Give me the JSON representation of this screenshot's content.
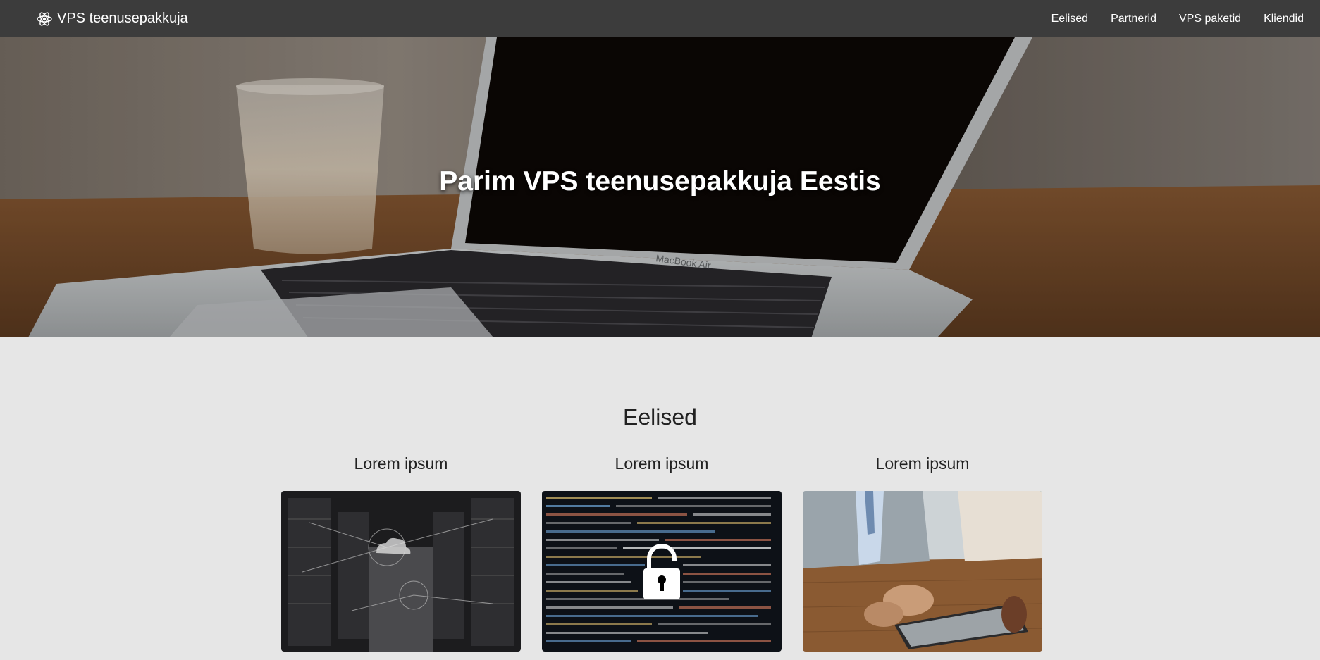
{
  "navbar": {
    "brand": "VPS teenusepakkuja",
    "links": [
      "Eelised",
      "Partnerid",
      "VPS paketid",
      "Kliendid"
    ]
  },
  "hero": {
    "title": "Parim VPS teenusepakkuja Eestis",
    "laptop_label": "MacBook Air"
  },
  "features": {
    "title": "Eelised",
    "cards": [
      {
        "title": "Lorem ipsum",
        "image": "server-room-cloud-image"
      },
      {
        "title": "Lorem ipsum",
        "image": "code-padlock-image"
      },
      {
        "title": "Lorem ipsum",
        "image": "business-tablet-image"
      }
    ]
  },
  "colors": {
    "navbar_bg": "#3c3c3c",
    "page_bg": "#e6e6e6",
    "text_dark": "#222222"
  }
}
